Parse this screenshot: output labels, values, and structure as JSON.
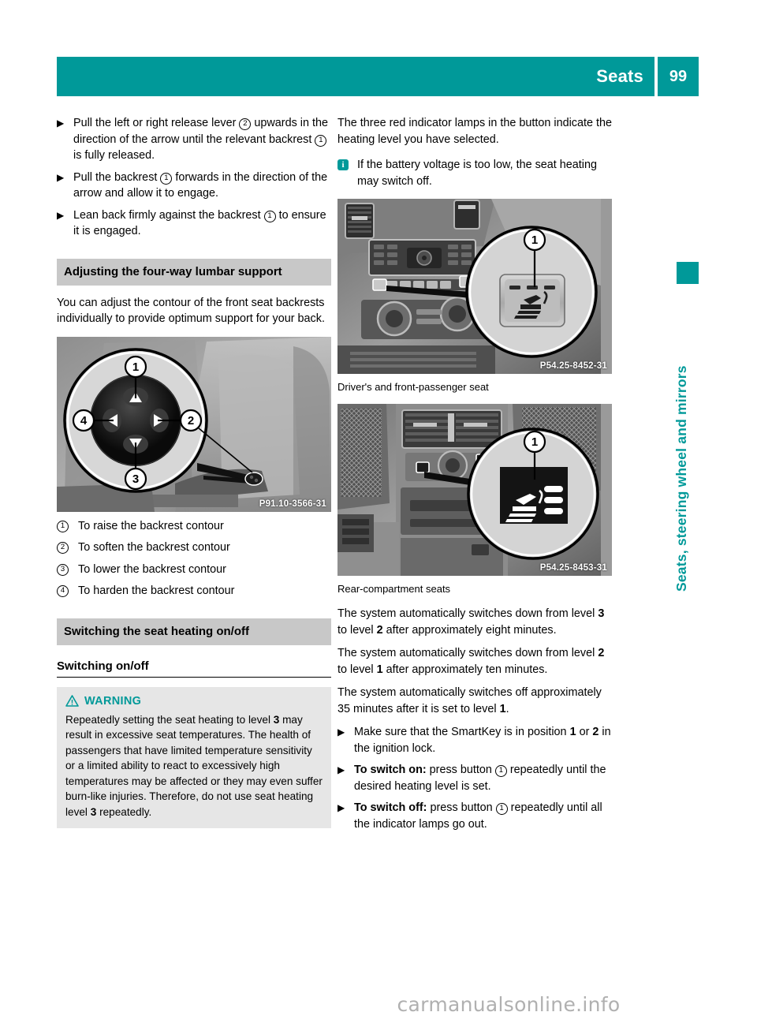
{
  "header": {
    "title": "Seats",
    "page_number": "99"
  },
  "side_tab": {
    "label": "Seats, steering wheel and mirrors",
    "color": "#009999"
  },
  "watermark": "carmanualsonline.info",
  "left_column": {
    "steps_top": [
      {
        "marker": "▶",
        "parts": [
          {
            "t": "Pull the left or right release lever "
          },
          {
            "c": "2"
          },
          {
            "t": " upwards in the direction of the arrow until the relevant backrest "
          },
          {
            "c": "1"
          },
          {
            "t": " is fully released."
          }
        ]
      },
      {
        "marker": "▶",
        "parts": [
          {
            "t": "Pull the backrest "
          },
          {
            "c": "1"
          },
          {
            "t": " forwards in the direction of the arrow and allow it to engage."
          }
        ]
      },
      {
        "marker": "▶",
        "parts": [
          {
            "t": "Lean back firmly against the backrest "
          },
          {
            "c": "1"
          },
          {
            "t": " to ensure it is engaged."
          }
        ]
      }
    ],
    "lumbar_heading": "Adjusting the four-way lumbar support",
    "lumbar_intro": "You can adjust the contour of the front seat backrests individually to provide optimum support for your back.",
    "lumbar_figure_id": "P91.10-3566-31",
    "lumbar_legend": [
      {
        "num": "1",
        "text": "To raise the backrest contour"
      },
      {
        "num": "2",
        "text": "To soften the backrest contour"
      },
      {
        "num": "3",
        "text": "To lower the backrest contour"
      },
      {
        "num": "4",
        "text": "To harden the backrest contour"
      }
    ],
    "heating_heading": "Switching the seat heating on/off",
    "heating_subheading": "Switching on/off",
    "warning": {
      "label": "WARNING",
      "icon": "warning-triangle-icon",
      "parts": [
        {
          "t": "Repeatedly setting the seat heating to level "
        },
        {
          "b": "3"
        },
        {
          "t": " may result in excessive seat temperatures. The health of passengers that have limited temperature sensitivity or a limited ability to react to excessively high temperatures may be affected or they may even suffer burn-like injuries. Therefore, do not use seat heating level "
        },
        {
          "b": "3"
        },
        {
          "t": " repeatedly."
        }
      ]
    }
  },
  "right_column": {
    "intro": "The three red indicator lamps in the button indicate the heating level you have selected.",
    "note": "If the battery voltage is too low, the seat heating may switch off.",
    "figure1_id": "P54.25-8452-31",
    "figure1_caption": "Driver's and front-passenger seat",
    "figure2_id": "P54.25-8453-31",
    "figure2_caption": "Rear-compartment seats",
    "paragraphs": [
      [
        {
          "t": "The system automatically switches down from level "
        },
        {
          "b": "3"
        },
        {
          "t": " to level "
        },
        {
          "b": "2"
        },
        {
          "t": " after approximately eight minutes."
        }
      ],
      [
        {
          "t": "The system automatically switches down from level "
        },
        {
          "b": "2"
        },
        {
          "t": " to level "
        },
        {
          "b": "1"
        },
        {
          "t": " after approximately ten minutes."
        }
      ],
      [
        {
          "t": "The system automatically switches off approximately 35 minutes after it is set to level "
        },
        {
          "b": "1"
        },
        {
          "t": "."
        }
      ]
    ],
    "steps": [
      {
        "marker": "▶",
        "parts": [
          {
            "t": "Make sure that the SmartKey is in position "
          },
          {
            "b": "1"
          },
          {
            "t": " or "
          },
          {
            "b": "2"
          },
          {
            "t": " in the ignition lock."
          }
        ]
      },
      {
        "marker": "▶",
        "parts": [
          {
            "b": "To switch on:"
          },
          {
            "t": " press button "
          },
          {
            "c": "1"
          },
          {
            "t": " repeatedly until the desired heating level is set."
          }
        ]
      },
      {
        "marker": "▶",
        "parts": [
          {
            "b": "To switch off:"
          },
          {
            "t": " press button "
          },
          {
            "c": "1"
          },
          {
            "t": " repeatedly until all the indicator lamps go out."
          }
        ]
      }
    ]
  }
}
